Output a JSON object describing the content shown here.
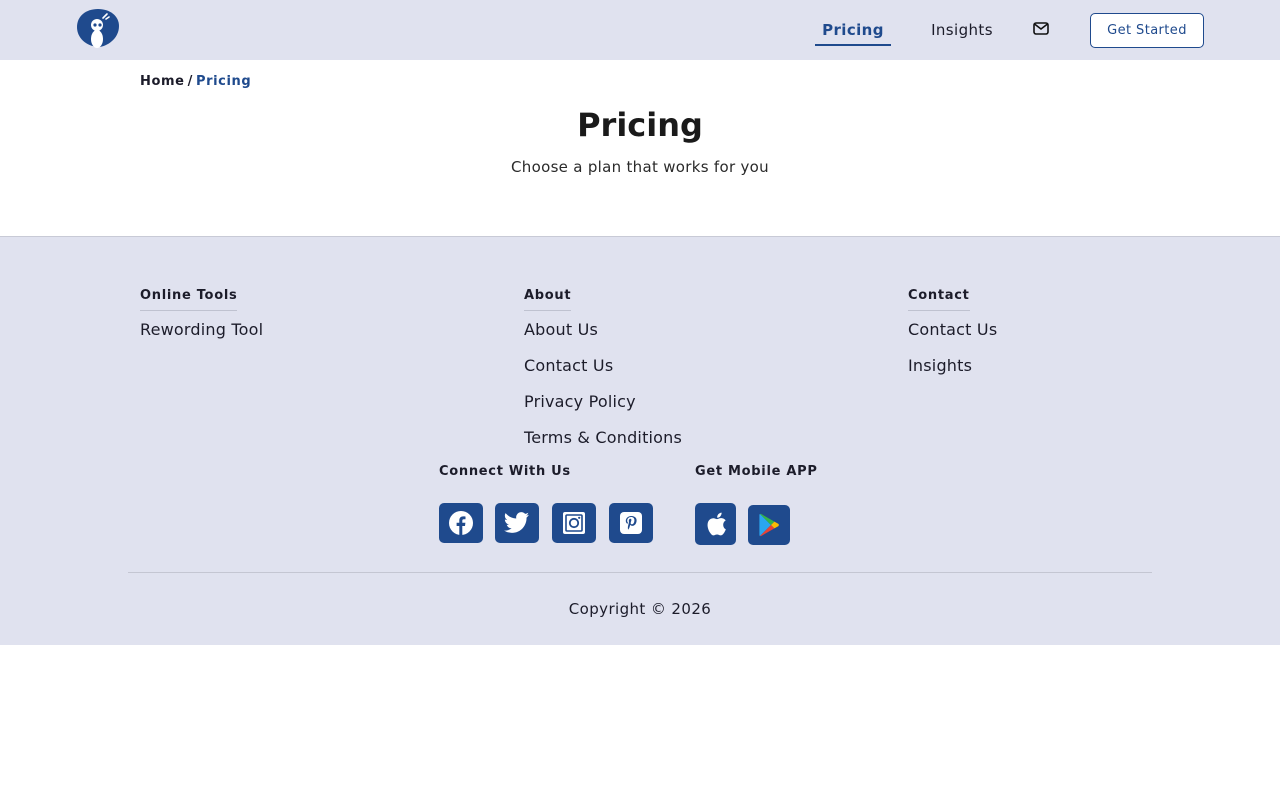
{
  "header": {
    "nav": {
      "pricing": "Pricing",
      "insights": "Insights"
    },
    "mail_icon": "envelope-icon",
    "cta": "Get Started"
  },
  "breadcrumb": {
    "home": "Home",
    "separator": "/",
    "current": "Pricing"
  },
  "hero": {
    "title": "Pricing",
    "subtitle": "Choose a plan that works for you"
  },
  "footer": {
    "columns": [
      {
        "heading": "Online Tools",
        "links": [
          "Rewording Tool"
        ]
      },
      {
        "heading": "About",
        "links": [
          "About Us",
          "Contact Us",
          "Privacy Policy",
          "Terms & Conditions"
        ]
      },
      {
        "heading": "Contact",
        "links": [
          "Contact Us",
          "Insights"
        ]
      }
    ],
    "connect_heading": "Connect With Us",
    "social": [
      "facebook-icon",
      "twitter-icon",
      "instagram-icon",
      "pinterest-icon"
    ],
    "app_heading": "Get Mobile APP",
    "apps": [
      "apple-icon",
      "google-play-icon"
    ],
    "copyright": "Copyright © 2026"
  },
  "colors": {
    "brand": "#1f4a8d",
    "header_bg": "#e0e2ef",
    "footer_bg": "#e0e2ef",
    "text": "#1c1c2a"
  }
}
